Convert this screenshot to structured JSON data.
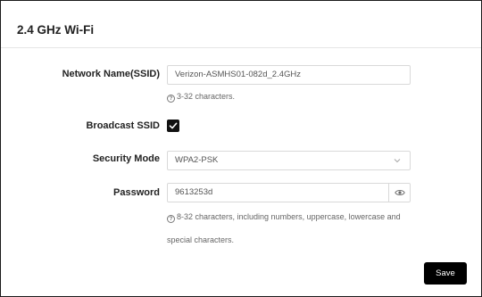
{
  "panel": {
    "title": "2.4 GHz Wi-Fi"
  },
  "ssid": {
    "label": "Network Name(SSID)",
    "value": "Verizon-ASMHS01-082d_2.4GHz",
    "hint": "3-32 characters."
  },
  "broadcast": {
    "label": "Broadcast SSID",
    "checked": true
  },
  "security": {
    "label": "Security Mode",
    "value": "WPA2-PSK"
  },
  "password": {
    "label": "Password",
    "value": "9613253d",
    "hint_line1": "8-32 characters, including numbers, uppercase, lowercase and",
    "hint_line2": "special characters."
  },
  "actions": {
    "save_label": "Save"
  }
}
